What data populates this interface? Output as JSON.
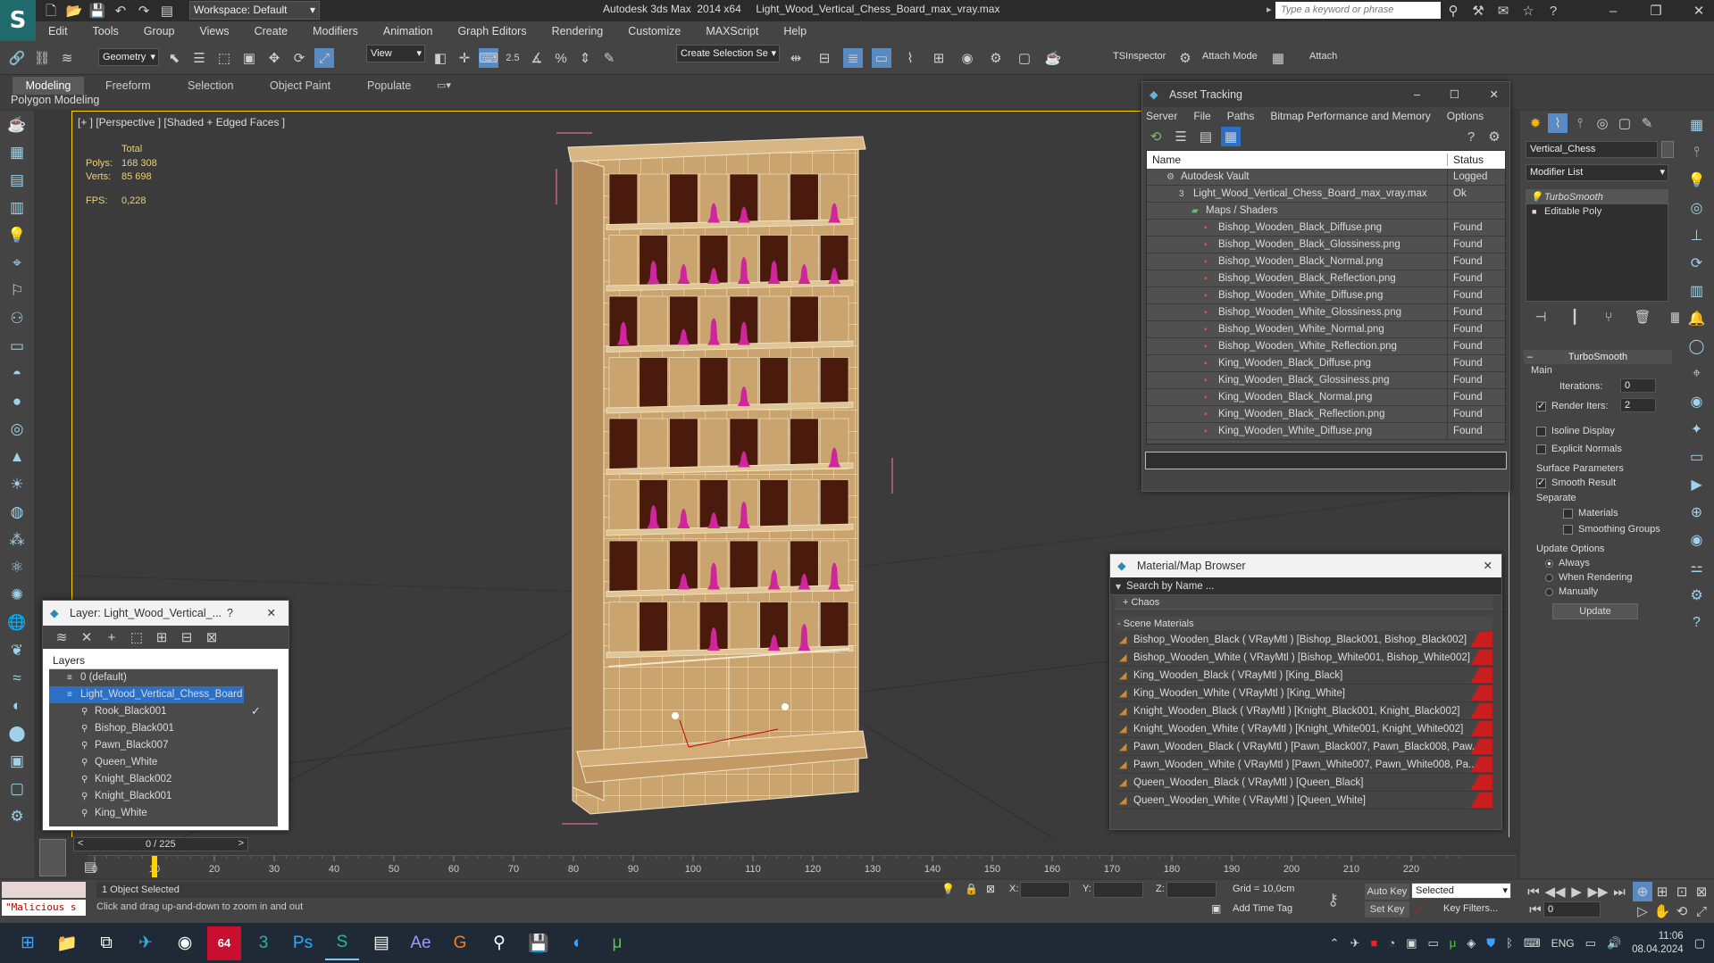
{
  "title_bar": {
    "workspace_label": "Workspace: Default",
    "app_title": "Autodesk 3ds Max  2014 x64     Light_Wood_Vertical_Chess_Board_max_vray.max",
    "search_placeholder": "Type a keyword or phrase"
  },
  "menu": [
    "Edit",
    "Tools",
    "Group",
    "Views",
    "Create",
    "Modifiers",
    "Animation",
    "Graph Editors",
    "Rendering",
    "Customize",
    "MAXScript",
    "Help"
  ],
  "toolbar": {
    "selection_filter": "Geometry",
    "reference_coord": "View",
    "snap_value": "2.5",
    "named_selection": "Create Selection Se",
    "tsinspector": "TSInspector",
    "attach_mode": "Attach Mode",
    "attach": "Attach"
  },
  "ribbon": {
    "tabs": [
      "Modeling",
      "Freeform",
      "Selection",
      "Object Paint",
      "Populate"
    ],
    "sub_label": "Polygon Modeling"
  },
  "viewport": {
    "label": "[+ ] [Perspective ] [Shaded + Edged Faces ]",
    "stats_total": "Total",
    "polys_label": "Polys:",
    "polys_value": "168 308",
    "verts_label": "Verts:",
    "verts_value": "85 698",
    "fps_label": "FPS:",
    "fps_value": "0,228"
  },
  "asset_tracking": {
    "title": "Asset Tracking",
    "menu": [
      "Server",
      "File",
      "Paths",
      "Bitmap Performance and Memory",
      "Options"
    ],
    "col_name": "Name",
    "col_status": "Status",
    "rows": [
      {
        "name": "Autodesk Vault",
        "status": "Logged",
        "icon": "vault-icon"
      },
      {
        "name": "Light_Wood_Vertical_Chess_Board_max_vray.max",
        "status": "Ok",
        "icon": "max-file-icon"
      },
      {
        "name": "Maps / Shaders",
        "status": "",
        "icon": "folder-icon"
      },
      {
        "name": "Bishop_Wooden_Black_Diffuse.png",
        "status": "Found",
        "icon": "png-icon"
      },
      {
        "name": "Bishop_Wooden_Black_Glossiness.png",
        "status": "Found",
        "icon": "png-icon"
      },
      {
        "name": "Bishop_Wooden_Black_Normal.png",
        "status": "Found",
        "icon": "png-icon"
      },
      {
        "name": "Bishop_Wooden_Black_Reflection.png",
        "status": "Found",
        "icon": "png-icon"
      },
      {
        "name": "Bishop_Wooden_White_Diffuse.png",
        "status": "Found",
        "icon": "png-icon"
      },
      {
        "name": "Bishop_Wooden_White_Glossiness.png",
        "status": "Found",
        "icon": "png-icon"
      },
      {
        "name": "Bishop_Wooden_White_Normal.png",
        "status": "Found",
        "icon": "png-icon"
      },
      {
        "name": "Bishop_Wooden_White_Reflection.png",
        "status": "Found",
        "icon": "png-icon"
      },
      {
        "name": "King_Wooden_Black_Diffuse.png",
        "status": "Found",
        "icon": "png-icon"
      },
      {
        "name": "King_Wooden_Black_Glossiness.png",
        "status": "Found",
        "icon": "png-icon"
      },
      {
        "name": "King_Wooden_Black_Normal.png",
        "status": "Found",
        "icon": "png-icon"
      },
      {
        "name": "King_Wooden_Black_Reflection.png",
        "status": "Found",
        "icon": "png-icon"
      },
      {
        "name": "King_Wooden_White_Diffuse.png",
        "status": "Found",
        "icon": "png-icon"
      }
    ]
  },
  "material_browser": {
    "title": "Material/Map Browser",
    "search_placeholder": "Search by Name ...",
    "group_chaos": "+ Chaos",
    "group_scene": "- Scene Materials",
    "items": [
      "Bishop_Wooden_Black  ( VRayMtl ) [Bishop_Black001, Bishop_Black002]",
      "Bishop_Wooden_White  ( VRayMtl ) [Bishop_White001, Bishop_White002]",
      "King_Wooden_Black  ( VRayMtl ) [King_Black]",
      "King_Wooden_White  ( VRayMtl ) [King_White]",
      "Knight_Wooden_Black  ( VRayMtl ) [Knight_Black001, Knight_Black002]",
      "Knight_Wooden_White  ( VRayMtl ) [Knight_White001, Knight_White002]",
      "Pawn_Wooden_Black  ( VRayMtl ) [Pawn_Black007, Pawn_Black008, Paw...",
      "Pawn_Wooden_White  ( VRayMtl ) [Pawn_White007, Pawn_White008, Pa...",
      "Queen_Wooden_Black  ( VRayMtl ) [Queen_Black]",
      "Queen_Wooden_White  ( VRayMtl ) [Queen_White]"
    ]
  },
  "layer_window": {
    "title": "Layer: Light_Wood_Vertical_...",
    "help": "?",
    "header": "Layers",
    "items": [
      {
        "label": "0 (default)",
        "indent": 1
      },
      {
        "label": "Light_Wood_Vertical_Chess_Board",
        "indent": 1,
        "selected": true
      },
      {
        "label": "Rook_Black001",
        "indent": 2
      },
      {
        "label": "Bishop_Black001",
        "indent": 2
      },
      {
        "label": "Pawn_Black007",
        "indent": 2
      },
      {
        "label": "Queen_White",
        "indent": 2
      },
      {
        "label": "Knight_Black002",
        "indent": 2
      },
      {
        "label": "Knight_Black001",
        "indent": 2
      },
      {
        "label": "King_White",
        "indent": 2
      }
    ]
  },
  "command_panel": {
    "object_name": "Vertical_Chess",
    "modifier_list": "Modifier List",
    "stack": [
      "TurboSmooth",
      "Editable Poly"
    ],
    "rollout_title": "TurboSmooth",
    "main_label": "Main",
    "iterations_label": "Iterations:",
    "iterations_value": "0",
    "render_iters_label": "Render Iters:",
    "render_iters_value": "2",
    "isoline_display": "Isoline Display",
    "explicit_normals": "Explicit Normals",
    "surface_params": "Surface Parameters",
    "smooth_result": "Smooth Result",
    "separate": "Separate",
    "materials": "Materials",
    "smoothing_groups": "Smoothing Groups",
    "update_options": "Update Options",
    "always": "Always",
    "when_rendering": "When Rendering",
    "manually": "Manually",
    "update_button": "Update"
  },
  "timeline": {
    "frame_counter": "0 / 225",
    "ticks": [
      "0",
      "10",
      "20",
      "30",
      "40",
      "50",
      "60",
      "70",
      "80",
      "90",
      "100",
      "110",
      "120",
      "130",
      "140",
      "150",
      "160",
      "170",
      "180",
      "190",
      "200",
      "210",
      "220"
    ]
  },
  "status": {
    "maxscript": "\"Malicious s",
    "selection_info": "1 Object Selected",
    "prompt": "Click and drag up-and-down to zoom in and out",
    "x_label": "X:",
    "y_label": "Y:",
    "z_label": "Z:",
    "grid": "Grid = 10,0cm",
    "add_time_tag": "Add Time Tag",
    "auto_key": "Auto Key",
    "set_key": "Set Key",
    "selected_dropdown": "Selected",
    "key_filters": "Key Filters...",
    "current_frame": "0"
  },
  "taskbar": {
    "badge_64": "64",
    "lang": "ENG",
    "time": "11:06",
    "date": "08.04.2024"
  },
  "colors": {
    "accent": "#ffd200",
    "piece": "#d1259e",
    "found_red": "#c81e1e",
    "selected_blue": "#2b6fc6"
  }
}
